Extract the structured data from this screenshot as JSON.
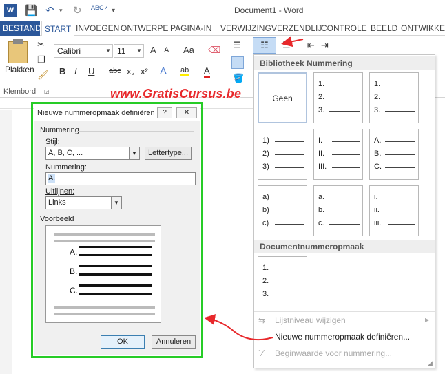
{
  "window": {
    "title": "Document1 - Word"
  },
  "tabs": [
    "BESTAND",
    "START",
    "INVOEGEN",
    "ONTWERPE",
    "PAGINA-IN",
    "VERWIJZING",
    "VERZENDLIJ",
    "CONTROLE",
    "BEELD",
    "ONTWIKKEL"
  ],
  "ribbon": {
    "paste_label": "Plakken",
    "clipboard_group": "Klembord",
    "font_name": "Calibri",
    "font_size": "11",
    "bold": "B",
    "italic": "I",
    "underline": "U",
    "strike": "abc",
    "subscript": "x₂",
    "superscript": "x²",
    "grow_font": "A",
    "shrink_font": "A",
    "change_case": "Aa",
    "text_effects": "A",
    "font_color": "A",
    "highlight_color": "ab"
  },
  "watermark": "www.GratisCursus.be",
  "dialog": {
    "title": "Nieuwe nummeropmaak definiëren",
    "help": "?",
    "close": "✕",
    "group_numbering": "Nummering",
    "style_label": "Stijl:",
    "style_value": "A, B, C, ...",
    "font_button": "Lettertype...",
    "format_label": "Nummering:",
    "format_value": "A.",
    "align_label": "Uitlijnen:",
    "align_value": "Links",
    "preview_label": "Voorbeeld",
    "preview_items": [
      "A.",
      "B.",
      "C."
    ],
    "ok": "OK",
    "cancel": "Annuleren"
  },
  "gallery": {
    "header_library": "Bibliotheek Nummering",
    "none_label": "Geen",
    "cells": [
      [
        "1.",
        "2.",
        "3."
      ],
      [
        "1.",
        "2.",
        "3."
      ],
      [
        "1)",
        "2)",
        "3)"
      ],
      [
        "I.",
        "II.",
        "III."
      ],
      [
        "A.",
        "B.",
        "C."
      ],
      [
        "a)",
        "b)",
        "c)"
      ],
      [
        "a.",
        "b.",
        "c."
      ],
      [
        "i.",
        "ii.",
        "iii."
      ]
    ],
    "header_document": "Documentnummeropmaak",
    "doc_cell": [
      "1.",
      "2.",
      "3."
    ],
    "menu_change_level": "Lijstniveau wijzigen",
    "menu_define_new": "Nieuwe nummeropmaak definiëren...",
    "menu_set_value": "Beginwaarde voor nummering..."
  },
  "colors": {
    "accent": "#2b579a",
    "highlight": "#26cc26",
    "annotation": "#e8282b"
  }
}
